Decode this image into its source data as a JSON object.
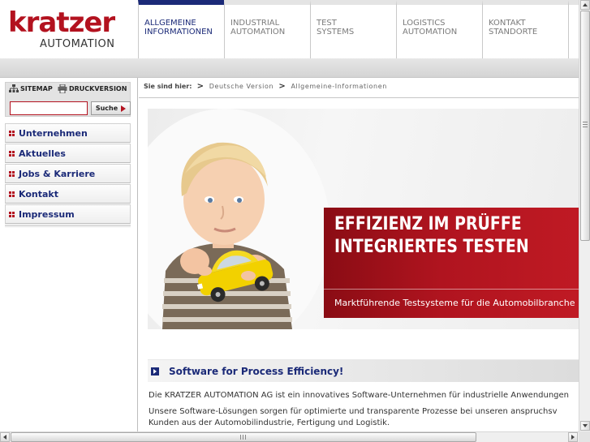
{
  "logo": {
    "main": "kratzer",
    "sub": "AUTOMATION"
  },
  "topnav": {
    "items": [
      {
        "label": "ALLGEMEINE\nINFORMATIONEN",
        "active": true
      },
      {
        "label": "INDUSTRIAL\nAUTOMATION",
        "active": false
      },
      {
        "label": "TEST\nSYSTEMS",
        "active": false
      },
      {
        "label": "LOGISTICS\nAUTOMATION",
        "active": false
      },
      {
        "label": "KONTAKT\nSTANDORTE",
        "active": false
      }
    ]
  },
  "utility": {
    "sitemap_label": "SITEMAP",
    "sitemap_icon": "sitemap-icon",
    "print_label": "DRUCKVERSION",
    "print_icon": "printer-icon"
  },
  "search": {
    "value": "",
    "button_label": "Suche",
    "button_icon": "arrow-right-icon"
  },
  "leftnav": {
    "items": [
      {
        "label": "Unternehmen"
      },
      {
        "label": "Aktuelles"
      },
      {
        "label": "Jobs & Karriere"
      },
      {
        "label": "Kontakt"
      },
      {
        "label": "Impressum"
      }
    ]
  },
  "breadcrumb": {
    "label": "Sie sind hier:",
    "items": [
      "Deutsche Version",
      "Allgemeine-Informationen"
    ]
  },
  "hero": {
    "headline_1": "EFFIZIENZ IM PRÜFFE",
    "headline_2": "INTEGRIERTES TESTEN",
    "subline": "Marktführende Testsysteme für die Automobilbranche"
  },
  "section": {
    "title": "Software for Process Efficiency!",
    "paragraph_1": "Die KRATZER AUTOMATION AG ist ein innovatives Software-Unternehmen für industrielle Anwendungen",
    "paragraph_2_line_1": "Unsere Software-Lösungen sorgen für optimierte und transparente Prozesse bei unseren anspruchsv",
    "paragraph_2_line_2": "Kunden aus der Automobilindustrie, Fertigung und Logistik."
  },
  "colors": {
    "brand_red": "#b3121f",
    "nav_blue": "#1b2a78",
    "banner_red": "#b0141f"
  }
}
